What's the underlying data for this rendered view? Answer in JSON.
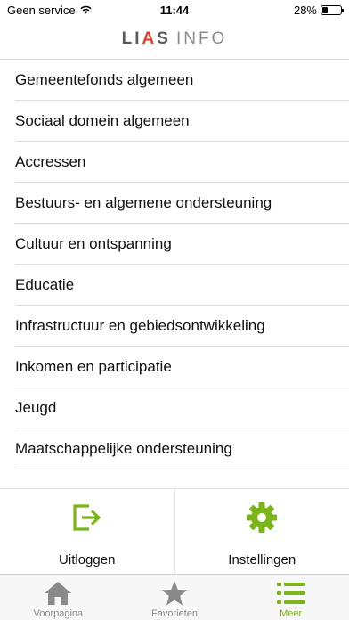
{
  "status_bar": {
    "carrier": "Geen service",
    "time": "11:44",
    "battery_percent": "28%",
    "battery_level": 0.28
  },
  "logo": {
    "text_main": "LI",
    "text_accent": "A",
    "text_end": "S",
    "text_info": "INFO"
  },
  "menu": {
    "items": [
      {
        "label": "Gemeentefonds algemeen"
      },
      {
        "label": "Sociaal domein algemeen"
      },
      {
        "label": "Accressen"
      },
      {
        "label": "Bestuurs- en algemene ondersteuning"
      },
      {
        "label": "Cultuur en ontspanning"
      },
      {
        "label": "Educatie"
      },
      {
        "label": "Infrastructuur en gebiedsontwikkeling"
      },
      {
        "label": "Inkomen en participatie"
      },
      {
        "label": "Jeugd"
      },
      {
        "label": "Maatschappelijke ondersteuning"
      }
    ]
  },
  "actions": {
    "logout": {
      "label": "Uitloggen",
      "icon": "logout-icon"
    },
    "settings": {
      "label": "Instellingen",
      "icon": "gear-icon"
    }
  },
  "tab_bar": {
    "tabs": [
      {
        "label": "Voorpagina",
        "icon": "home-icon",
        "active": false
      },
      {
        "label": "Favorieten",
        "icon": "star-icon",
        "active": false
      },
      {
        "label": "Meer",
        "icon": "list-icon",
        "active": true
      }
    ]
  },
  "colors": {
    "accent_green": "#7cb518",
    "logo_red": "#e23d2b",
    "inactive_gray": "#8a8a8a"
  }
}
